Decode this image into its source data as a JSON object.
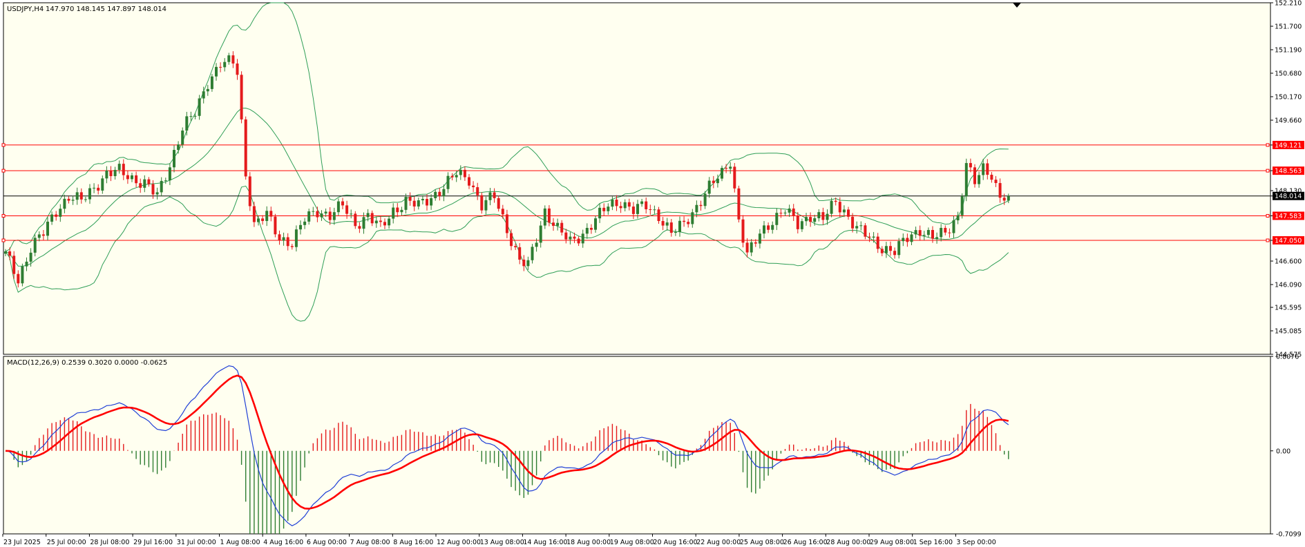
{
  "chart_header": {
    "symbol_tf": "USDJPY,H4",
    "ohlc": "147.970 148.145 147.897 148.014"
  },
  "macd_header": {
    "label": "MACD(12,26,9) 0.2539 0.3020 0.0000 -0.0625"
  },
  "colors": {
    "background": "#fffff0",
    "bull": "#2e7d32",
    "bear": "#e41a1c",
    "bands": "#2e9e56",
    "hline": "#ff0000",
    "macd": "#1f3fd6",
    "signal": "#ff0000",
    "hist_pos": "#e41a1c",
    "hist_neg": "#2e7d32"
  },
  "price_axis": {
    "ticks": [
      "152.210",
      "151.700",
      "151.190",
      "150.680",
      "150.170",
      "149.660",
      "149.121",
      "148.563",
      "148.130",
      "148.014",
      "147.583",
      "147.050",
      "146.600",
      "146.090",
      "145.595",
      "145.085",
      "144.575"
    ],
    "current_price": "148.014"
  },
  "macd_axis": {
    "ticks": [
      "0.8076",
      "0.00",
      "-0.7099"
    ]
  },
  "time_axis": {
    "labels": [
      "23 Jul 2025",
      "25 Jul 00:00",
      "28 Jul 08:00",
      "29 Jul 16:00",
      "31 Jul 00:00",
      "1 Aug 08:00",
      "4 Aug 16:00",
      "6 Aug 00:00",
      "7 Aug 08:00",
      "8 Aug 16:00",
      "12 Aug 00:00",
      "13 Aug 08:00",
      "14 Aug 16:00",
      "18 Aug 00:00",
      "19 Aug 08:00",
      "20 Aug 16:00",
      "22 Aug 00:00",
      "25 Aug 08:00",
      "26 Aug 16:00",
      "28 Aug 00:00",
      "29 Aug 08:00",
      "1 Sep 16:00",
      "3 Sep 00:00"
    ]
  },
  "horizontal_lines": [
    {
      "price": 149.121,
      "label": "149.121",
      "color": "#ff0000"
    },
    {
      "price": 148.563,
      "label": "148.563",
      "color": "#ff0000"
    },
    {
      "price": 148.014,
      "label": "148.014",
      "color": "#000000"
    },
    {
      "price": 147.583,
      "label": "147.583",
      "color": "#ff0000"
    },
    {
      "price": 147.05,
      "label": "147.050",
      "color": "#ff0000"
    }
  ],
  "chart_data": [
    {
      "type": "candlestick",
      "title": "USDJPY,H4",
      "ylim": [
        144.575,
        152.21
      ],
      "grid": false,
      "anchors": [
        [
          0,
          146.75
        ],
        [
          3,
          146.2
        ],
        [
          6,
          146.9
        ],
        [
          9,
          147.2
        ],
        [
          12,
          147.7
        ],
        [
          15,
          148.0
        ],
        [
          18,
          147.9
        ],
        [
          21,
          148.2
        ],
        [
          24,
          148.5
        ],
        [
          27,
          148.55
        ],
        [
          30,
          148.4
        ],
        [
          33,
          148.3
        ],
        [
          36,
          148.0
        ],
        [
          39,
          148.7
        ],
        [
          42,
          149.5
        ],
        [
          45,
          149.8
        ],
        [
          48,
          150.5
        ],
        [
          51,
          150.9
        ],
        [
          54,
          150.9
        ],
        [
          55,
          150.7
        ],
        [
          57,
          148.5
        ],
        [
          59,
          147.4
        ],
        [
          62,
          147.6
        ],
        [
          65,
          147.1
        ],
        [
          68,
          147.0
        ],
        [
          71,
          147.5
        ],
        [
          74,
          147.7
        ],
        [
          77,
          147.6
        ],
        [
          80,
          147.8
        ],
        [
          83,
          147.4
        ],
        [
          86,
          147.6
        ],
        [
          89,
          147.3
        ],
        [
          92,
          147.7
        ],
        [
          95,
          147.9
        ],
        [
          98,
          147.8
        ],
        [
          101,
          148.0
        ],
        [
          104,
          148.2
        ],
        [
          107,
          148.5
        ],
        [
          110,
          148.4
        ],
        [
          113,
          147.8
        ],
        [
          116,
          148.0
        ],
        [
          119,
          147.3
        ],
        [
          122,
          146.6
        ],
        [
          124,
          146.5
        ],
        [
          126,
          147.1
        ],
        [
          128,
          147.7
        ],
        [
          131,
          147.3
        ],
        [
          134,
          147.0
        ],
        [
          137,
          147.2
        ],
        [
          140,
          147.5
        ],
        [
          143,
          147.8
        ],
        [
          146,
          147.9
        ],
        [
          149,
          147.7
        ],
        [
          152,
          147.8
        ],
        [
          155,
          147.6
        ],
        [
          158,
          147.2
        ],
        [
          161,
          147.4
        ],
        [
          164,
          147.8
        ],
        [
          167,
          148.2
        ],
        [
          170,
          148.5
        ],
        [
          172,
          148.8
        ],
        [
          174,
          147.5
        ],
        [
          176,
          146.7
        ],
        [
          179,
          147.2
        ],
        [
          182,
          147.5
        ],
        [
          185,
          147.7
        ],
        [
          188,
          147.4
        ],
        [
          191,
          147.6
        ],
        [
          194,
          147.5
        ],
        [
          197,
          147.9
        ],
        [
          199,
          147.7
        ],
        [
          202,
          147.3
        ],
        [
          205,
          147.1
        ],
        [
          208,
          146.9
        ],
        [
          211,
          146.8
        ],
        [
          214,
          147.1
        ],
        [
          217,
          147.3
        ],
        [
          220,
          147.1
        ],
        [
          223,
          147.2
        ],
        [
          226,
          147.6
        ],
        [
          228,
          148.7
        ],
        [
          230,
          148.3
        ],
        [
          232,
          148.6
        ],
        [
          234,
          148.5
        ],
        [
          236,
          148.0
        ],
        [
          238,
          148.014
        ]
      ]
    },
    {
      "type": "line",
      "title": "MACD(12,26,9)",
      "ylim": [
        -0.7099,
        0.8076
      ],
      "series": [
        {
          "name": "MACD",
          "values": [
            -0.2539
          ]
        },
        {
          "name": "Signal",
          "values": [
            0.302
          ]
        }
      ]
    }
  ]
}
